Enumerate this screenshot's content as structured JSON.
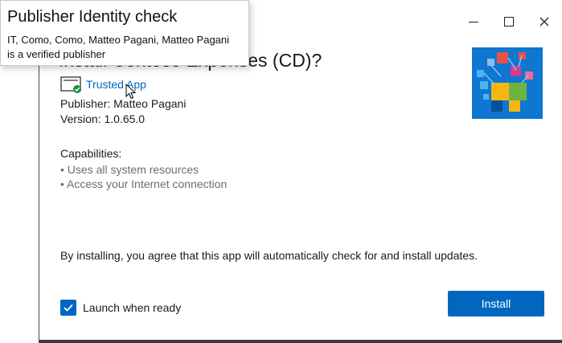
{
  "window": {
    "title": "Install Contoso Expenses (CD)?",
    "controls": {
      "minimize_icon": "minimize-icon",
      "maximize_icon": "maximize-icon",
      "close_icon": "close-icon"
    }
  },
  "app": {
    "trusted_label": "Trusted App",
    "publisher": "Publisher: Matteo Pagani",
    "version": "Version: 1.0.65.0",
    "logo_icon": "contoso-logo-icon"
  },
  "capabilities": {
    "heading": "Capabilities:",
    "items": [
      "• Uses all system resources",
      "• Access your Internet connection"
    ]
  },
  "agreement": "By installing, you agree that this app will automatically check for and install updates.",
  "launch": {
    "label": "Launch when ready",
    "checked": true
  },
  "install_button": "Install",
  "tooltip": {
    "title": "Publisher Identity check",
    "line1": "IT, Como, Como, Matteo Pagani, Matteo Pagani",
    "line2": "is a verified publisher"
  },
  "colors": {
    "accent": "#0067c0",
    "logo_bg": "#0f77d2"
  }
}
